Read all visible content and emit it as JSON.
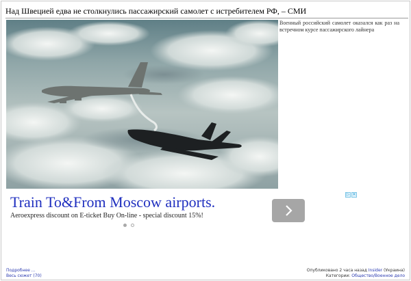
{
  "article": {
    "headline": "Над Швецией едва не столкнулись пассажирский самолет с истребителем РФ, – СМИ",
    "summary": "Военный российский самолет оказался как раз на встречном курсе пассажирского лайнера"
  },
  "ad": {
    "title": "Train To&From Moscow airports.",
    "text": "Aeroexpress discount on E-ticket Buy On-line - special discount 15%!",
    "badge_icons": [
      "adchoices-icon",
      "close-icon"
    ]
  },
  "footer": {
    "more_link": "Подробнее ...",
    "plot_link": "Весь сюжет (70)",
    "published_prefix": "Опубликовано 2 часа назад",
    "source": "Insider",
    "source_country": "(Украина)",
    "category_label": "Категории:",
    "category": "Общество/Военное дело"
  },
  "colors": {
    "ad_title": "#1f2fbf",
    "link": "#2a3ab0",
    "next_button": "#a6a6a6"
  }
}
